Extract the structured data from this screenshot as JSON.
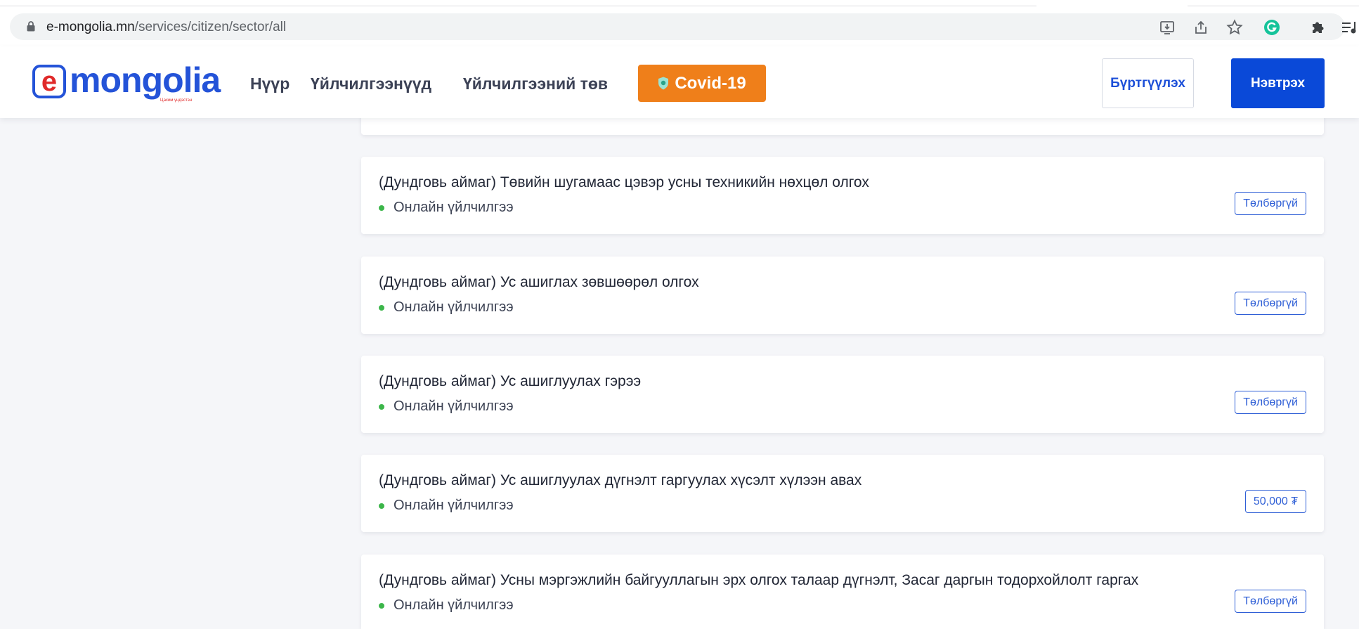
{
  "browser": {
    "url_host": "e-mongolia.mn",
    "url_path": "/services/citizen/sector/all"
  },
  "header": {
    "logo_letter": "e",
    "logo_word": "mongolia",
    "logo_tagline": "Цахим үндэстэн",
    "nav": [
      "Нүүр",
      "Үйлчилгээнүүд",
      "Үйлчилгээний төв"
    ],
    "covid_label": "Covid-19",
    "register_label": "Бүртгүүлэх",
    "login_label": "Нэвтрэх"
  },
  "colors": {
    "brand_blue": "#2453d8",
    "logo_red": "#e02a2a",
    "covid_orange": "#ef7f1a",
    "login_blue": "#0a49d8",
    "online_dot_green": "#3cb64a"
  },
  "services": [
    {
      "title": "(Дундговь аймаг) Төвийн шугамаас цэвэр усны техникийн нөхцөл олгох",
      "type": "Онлайн үйлчилгээ",
      "price": "Төлбөргүй"
    },
    {
      "title": "(Дундговь аймаг) Ус ашиглах зөвшөөрөл олгох",
      "type": "Онлайн үйлчилгээ",
      "price": "Төлбөргүй"
    },
    {
      "title": "(Дундговь аймаг) Ус ашиглуулах гэрээ",
      "type": "Онлайн үйлчилгээ",
      "price": "Төлбөргүй"
    },
    {
      "title": "(Дундговь аймаг) Ус ашиглуулах дүгнэлт гаргуулах хүсэлт хүлээн авах",
      "type": "Онлайн үйлчилгээ",
      "price": "50,000 ₮"
    },
    {
      "title": "(Дундговь аймаг) Усны мэргэжлийн байгууллагын эрх олгох талаар дүгнэлт, Засаг даргын тодорхойлолт гаргах",
      "type": "Онлайн үйлчилгээ",
      "price": "Төлбөргүй"
    }
  ]
}
